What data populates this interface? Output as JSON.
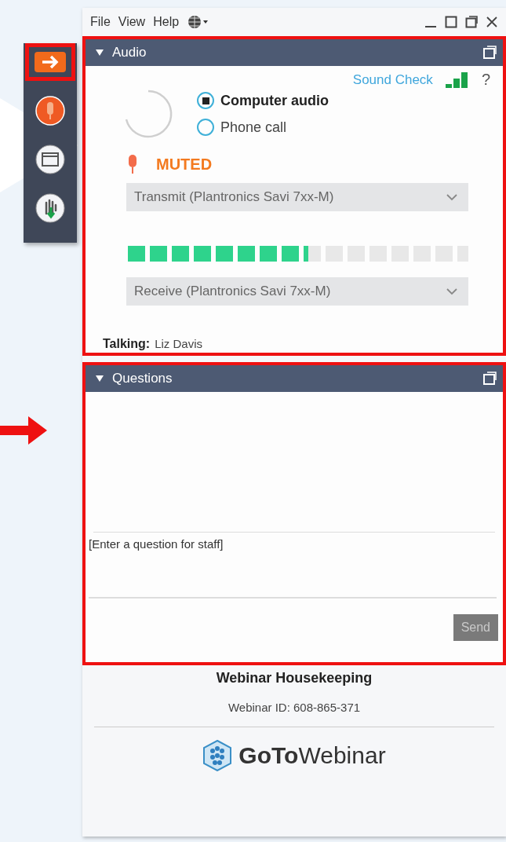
{
  "menu": [
    "File",
    "View",
    "Help"
  ],
  "sidebar": {
    "items": [
      {
        "kind": "exit",
        "highlighted": true
      },
      {
        "kind": "microphone",
        "highlighted": false
      },
      {
        "kind": "screen",
        "highlighted": false
      },
      {
        "kind": "hand",
        "highlighted": false
      }
    ]
  },
  "audio": {
    "title": "Audio",
    "highlighted": true,
    "sound_check": "Sound Check",
    "help": "?",
    "options": [
      {
        "label": "Computer audio",
        "selected": true
      },
      {
        "label": "Phone call",
        "selected": false
      }
    ],
    "muted": true,
    "status": "MUTED",
    "transmit": "Transmit (Plantronics Savi 7xx-M)",
    "level": 0.53,
    "receive": "Receive (Plantronics Savi 7xx-M)",
    "talking_label": "Talking:",
    "talking_name": "Liz Davis"
  },
  "questions": {
    "title": "Questions",
    "highlighted": true,
    "placeholder": "[Enter a question for staff]",
    "send": "Send"
  },
  "footer": {
    "title": "Webinar Housekeeping",
    "webinar_id": "Webinar ID: 608-865-371",
    "logo_bold": "GoTo",
    "logo_light": "Webinar"
  }
}
